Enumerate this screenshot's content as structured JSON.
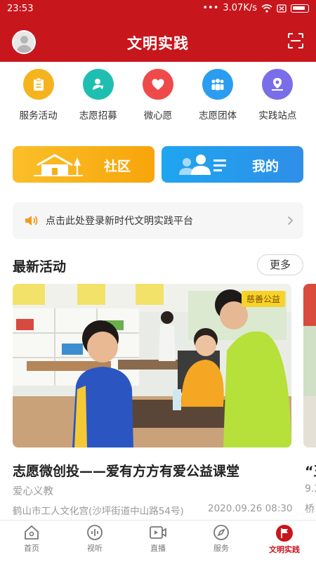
{
  "status_bar": {
    "time": "23:53",
    "network_speed": "3.07K/s"
  },
  "app": {
    "title": "文明实践"
  },
  "quick_actions": [
    {
      "label": "服务活动",
      "icon": "clipboard-icon",
      "color": "#f5b41e"
    },
    {
      "label": "志愿招募",
      "icon": "volunteer-icon",
      "color": "#1ebfb0"
    },
    {
      "label": "微心愿",
      "icon": "heart-icon",
      "color": "#ef4a4a"
    },
    {
      "label": "志愿团体",
      "icon": "group-icon",
      "color": "#2b9df0"
    },
    {
      "label": "实践站点",
      "icon": "location-pin-icon",
      "color": "#7a6ee8"
    }
  ],
  "big_buttons": {
    "community": "社区",
    "mine": "我的"
  },
  "notice": {
    "text": "点击此处登录新时代文明实践平台"
  },
  "section": {
    "title": "最新活动",
    "more": "更多"
  },
  "card": {
    "tag": "慈善公益",
    "title": "志愿微创投——爱有方方有爱公益课堂",
    "subtitle": "爱心义教",
    "location": "鹤山市工人文化宫(沙坪街道中山路54号)",
    "time": "2020.09.26 08:30"
  },
  "peek_card": {
    "title": "“王",
    "subtitle": "9.2",
    "location": "桥"
  },
  "tabs": [
    {
      "label": "首页",
      "icon": "home-icon"
    },
    {
      "label": "视听",
      "icon": "audio-icon"
    },
    {
      "label": "直播",
      "icon": "live-icon"
    },
    {
      "label": "服务",
      "icon": "compass-icon"
    },
    {
      "label": "文明实践",
      "icon": "flag-icon",
      "active": true
    }
  ],
  "colors": {
    "brand_red": "#c8161d",
    "community_yellow": "#f7a50a",
    "mine_blue": "#2f8ee8",
    "tag_yellow": "#f7d32a"
  }
}
